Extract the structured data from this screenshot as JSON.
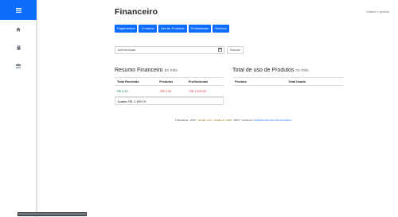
{
  "page": {
    "title": "Financeiro",
    "top_right_link": "Gastos e ganhos"
  },
  "sidebar": {
    "items": [
      {
        "icon": "menu-icon"
      },
      {
        "icon": "home-icon"
      },
      {
        "icon": "book-icon"
      },
      {
        "icon": "users-icon"
      }
    ]
  },
  "tabs": [
    "Pagamentos",
    "Compras",
    "Uso de Produtos",
    "Profissionais",
    "Recibos"
  ],
  "filter": {
    "date_placeholder": "dd/mm/aaaa",
    "search_label": "Buscar"
  },
  "summary": {
    "title": "Resumo Financeiro",
    "title_suffix": "do mês",
    "headers": [
      "Total Recebido",
      "Produtos",
      "Profissionais"
    ],
    "row": [
      "R$ 0,00",
      "-R$ 0,00",
      "-R$ 1.600,00"
    ],
    "profit_label": "Lucro:",
    "profit_value": "R$ -1.600,00"
  },
  "products": {
    "title": "Total de uso de Produtos",
    "title_suffix": "no mês",
    "headers": [
      "Produto",
      "Total Usado"
    ]
  },
  "footer": {
    "prefix": "© Rodolexa - 2013 ·",
    "version": "Versão 1.0.0 - criada em: 2023",
    "middle": "- 2023 · Criado por:",
    "author_link": "Rodolexa Serviços de Informática"
  },
  "colors": {
    "primary": "#0d6efd",
    "negative": "#dc3545",
    "positive": "#198754"
  }
}
